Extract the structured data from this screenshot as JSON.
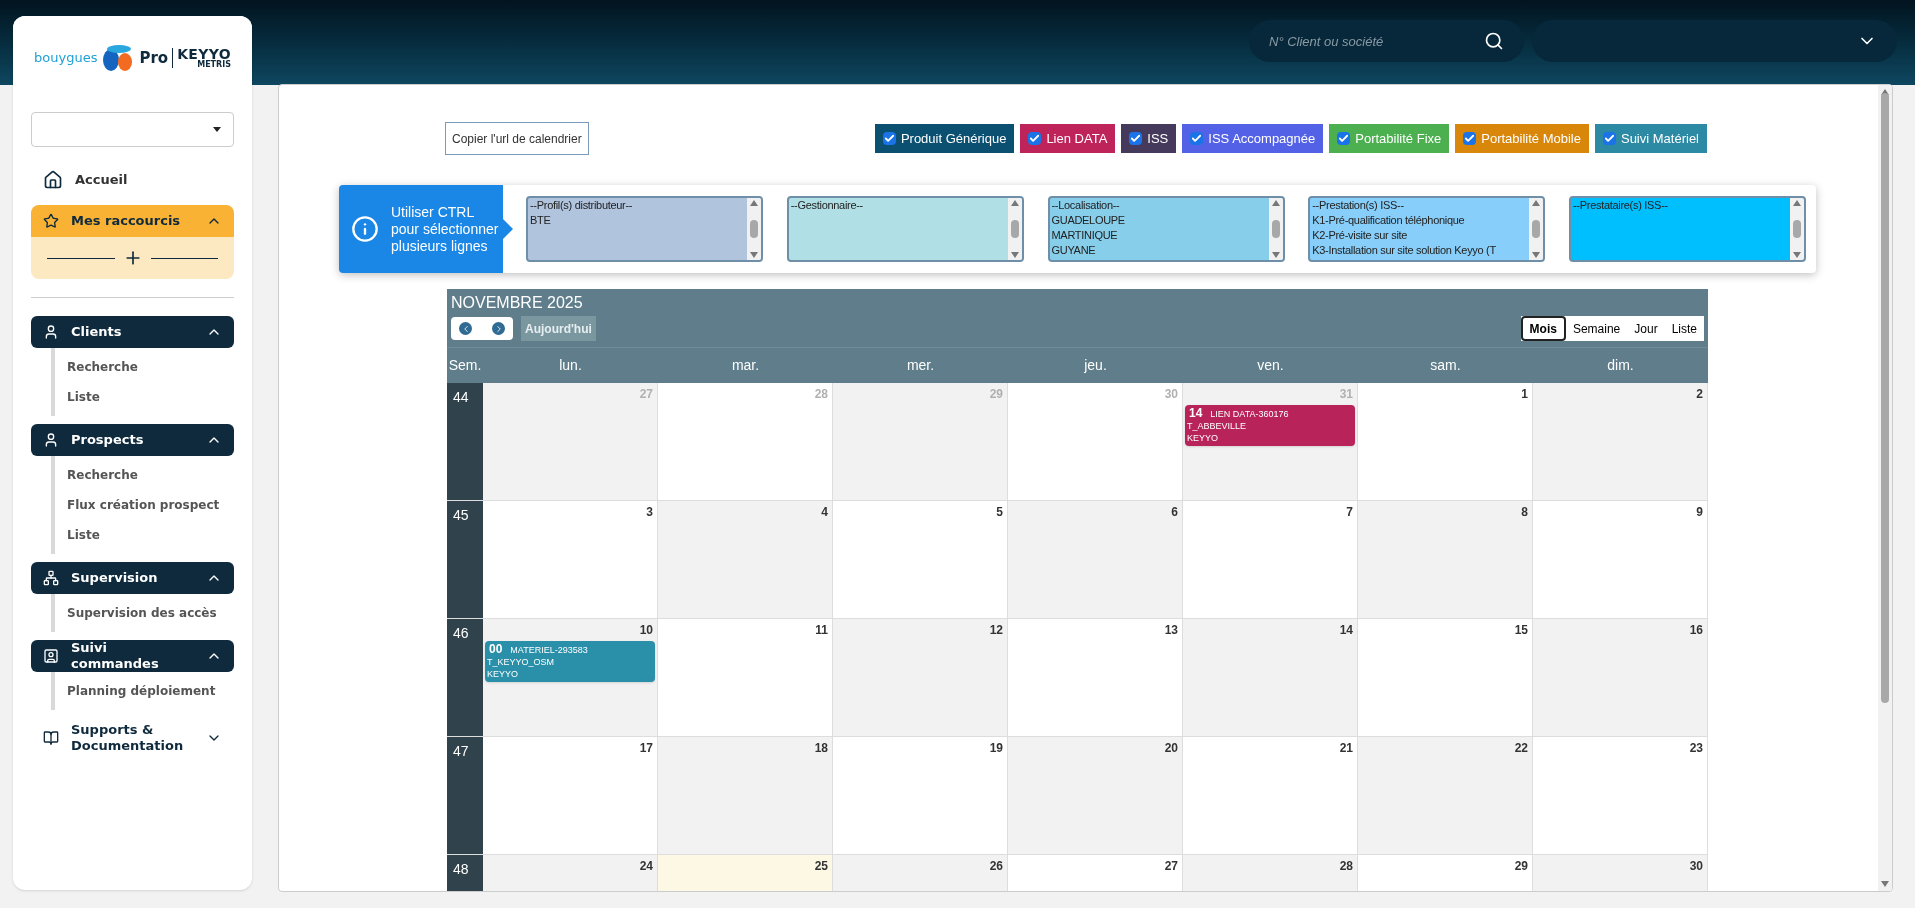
{
  "logo": {
    "brand": "bouygues",
    "product": "Pro",
    "partner": "KEYYO",
    "partner_sub": "METRIS"
  },
  "header": {
    "search": {
      "placeholder": "N° Client ou société"
    }
  },
  "sidebar": {
    "items": [
      {
        "kind": "link",
        "label": "Accueil"
      },
      {
        "kind": "shortcuts",
        "label": "Mes raccourcis",
        "expanded": true
      },
      {
        "kind": "section",
        "label": "Clients",
        "expanded": true,
        "children": [
          {
            "label": "Recherche"
          },
          {
            "label": "Liste"
          }
        ]
      },
      {
        "kind": "section",
        "label": "Prospects",
        "expanded": true,
        "children": [
          {
            "label": "Recherche"
          },
          {
            "label": "Flux création prospect"
          },
          {
            "label": "Liste"
          }
        ]
      },
      {
        "kind": "section",
        "label": "Supervision",
        "expanded": true,
        "children": [
          {
            "label": "Supervision des accès"
          }
        ]
      },
      {
        "kind": "section",
        "label": "Suivi commandes",
        "expanded": true,
        "children": [
          {
            "label": "Planning déploiement"
          }
        ]
      },
      {
        "kind": "section",
        "label": "Supports & Documentation",
        "expanded": false
      }
    ]
  },
  "copy_button": "Copier l'url de calendrier",
  "filters": [
    {
      "label": "Produit Générique",
      "checked": true,
      "color": "#0b4f71"
    },
    {
      "label": "Lien DATA",
      "checked": true,
      "color": "#be2459"
    },
    {
      "label": "ISS",
      "checked": true,
      "color": "#453a5c"
    },
    {
      "label": "ISS Accompagnée",
      "checked": true,
      "color": "#5361e6"
    },
    {
      "label": "Portabilité Fixe",
      "checked": true,
      "color": "#4caf50"
    },
    {
      "label": "Portabilité Mobile",
      "checked": true,
      "color": "#d8870b"
    },
    {
      "label": "Suivi Matériel",
      "checked": true,
      "color": "#2c8aa4"
    }
  ],
  "hint": "Utiliser CTRL pour sélectionner plusieurs lignes",
  "selects": [
    {
      "color": "#b0c4de",
      "options": [
        "--Profil(s) distributeur--",
        "BTE"
      ]
    },
    {
      "color": "#b0e0e6",
      "options": [
        "--Gestionnaire--"
      ]
    },
    {
      "color": "#87ceeb",
      "options": [
        "--Localisation--",
        "GUADELOUPE",
        "MARTINIQUE",
        "GUYANE"
      ]
    },
    {
      "color": "#87cefa",
      "options": [
        "--Prestation(s) ISS--",
        "K1-Pré-qualification téléphonique",
        "K2-Pré-visite sur site",
        "K3-Installation sur site solution Keyyo (T"
      ]
    },
    {
      "color": "#00bfff",
      "options": [
        "--Prestataire(s) ISS--"
      ]
    }
  ],
  "calendar": {
    "title": "NOVEMBRE 2025",
    "today_button": "Aujourd'hui",
    "views": [
      {
        "label": "Mois",
        "selected": true
      },
      {
        "label": "Semaine",
        "selected": false
      },
      {
        "label": "Jour",
        "selected": false
      },
      {
        "label": "Liste",
        "selected": false
      }
    ],
    "week_header": "Sem.",
    "day_names": [
      "lun.",
      "mar.",
      "mer.",
      "jeu.",
      "ven.",
      "sam.",
      "dim."
    ],
    "weeks": [
      {
        "number": "44",
        "days": [
          {
            "label": "27",
            "other_month": true,
            "today": false
          },
          {
            "label": "28",
            "other_month": true,
            "today": false
          },
          {
            "label": "29",
            "other_month": true,
            "today": false
          },
          {
            "label": "30",
            "other_month": true,
            "today": false
          },
          {
            "label": "31",
            "other_month": true,
            "today": false,
            "events": [
              {
                "time": "14",
                "title": "LIEN DATA-360176",
                "lines": [
                  "T_ABBEVILLE",
                  "KEYYO"
                ],
                "color": "#b8245a"
              }
            ]
          },
          {
            "label": "1",
            "other_month": false,
            "today": false
          },
          {
            "label": "2",
            "other_month": false,
            "today": false
          }
        ]
      },
      {
        "number": "45",
        "days": [
          {
            "label": "3",
            "other_month": false,
            "today": false
          },
          {
            "label": "4",
            "other_month": false,
            "today": false
          },
          {
            "label": "5",
            "other_month": false,
            "today": false
          },
          {
            "label": "6",
            "other_month": false,
            "today": false
          },
          {
            "label": "7",
            "other_month": false,
            "today": false
          },
          {
            "label": "8",
            "other_month": false,
            "today": false
          },
          {
            "label": "9",
            "other_month": false,
            "today": false
          }
        ]
      },
      {
        "number": "46",
        "days": [
          {
            "label": "10",
            "other_month": false,
            "today": false,
            "events": [
              {
                "time": "00",
                "title": "MATERIEL-293583",
                "lines": [
                  "T_KEYYO_OSM",
                  "KEYYO"
                ],
                "color": "#2a8fa8"
              }
            ]
          },
          {
            "label": "11",
            "other_month": false,
            "today": false
          },
          {
            "label": "12",
            "other_month": false,
            "today": false
          },
          {
            "label": "13",
            "other_month": false,
            "today": false
          },
          {
            "label": "14",
            "other_month": false,
            "today": false
          },
          {
            "label": "15",
            "other_month": false,
            "today": false
          },
          {
            "label": "16",
            "other_month": false,
            "today": false
          }
        ]
      },
      {
        "number": "47",
        "days": [
          {
            "label": "17",
            "other_month": false,
            "today": false
          },
          {
            "label": "18",
            "other_month": false,
            "today": false
          },
          {
            "label": "19",
            "other_month": false,
            "today": false
          },
          {
            "label": "20",
            "other_month": false,
            "today": false
          },
          {
            "label": "21",
            "other_month": false,
            "today": false
          },
          {
            "label": "22",
            "other_month": false,
            "today": false
          },
          {
            "label": "23",
            "other_month": false,
            "today": false
          }
        ]
      },
      {
        "number": "48",
        "days": [
          {
            "label": "24",
            "other_month": false,
            "today": false
          },
          {
            "label": "25",
            "other_month": false,
            "today": true
          },
          {
            "label": "26",
            "other_month": false,
            "today": false
          },
          {
            "label": "27",
            "other_month": false,
            "today": false
          },
          {
            "label": "28",
            "other_month": false,
            "today": false
          },
          {
            "label": "29",
            "other_month": false,
            "today": false
          },
          {
            "label": "30",
            "other_month": false,
            "today": false
          }
        ]
      }
    ]
  }
}
